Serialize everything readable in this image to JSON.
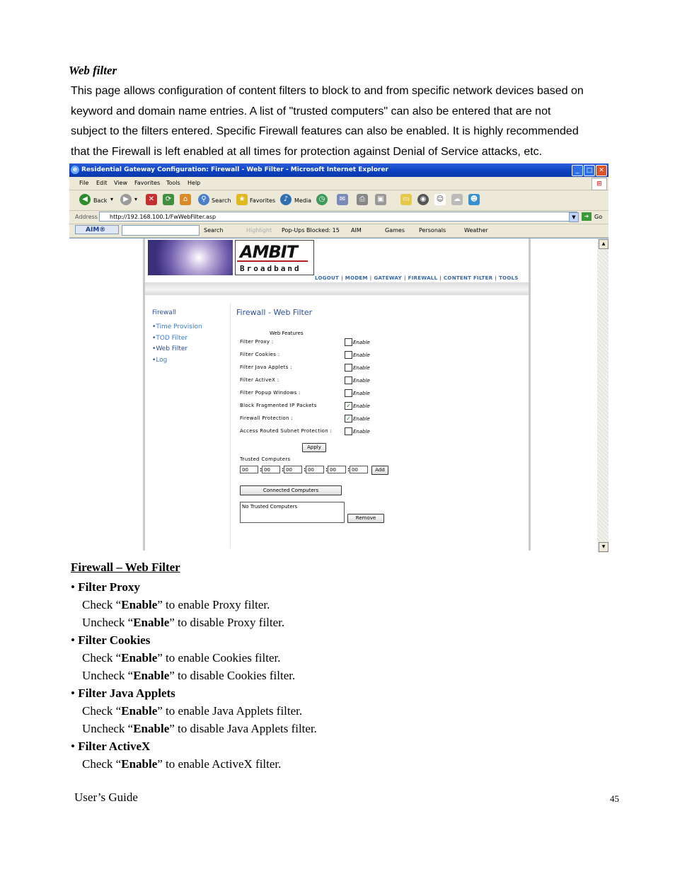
{
  "intro": {
    "title": "Web filter",
    "paragraph_lines": [
      "This page allows configuration of content filters to block to and from specific network devices based on",
      "keyword and domain name entries. A list of \"trusted computers\" can also be entered that are not",
      "subject to the filters entered. Specific Firewall features can also be enabled. It is highly recommended",
      "that the Firewall is left enabled at all times for protection against Denial of Service attacks, etc."
    ]
  },
  "browser": {
    "window_title": "Residential Gateway Configuration: Firewall - Web Filter - Microsoft Internet Explorer",
    "menu": [
      "File",
      "Edit",
      "View",
      "Favorites",
      "Tools",
      "Help"
    ],
    "toolbar": {
      "back": "Back",
      "search": "Search",
      "favorites": "Favorites",
      "media": "Media"
    },
    "address_label": "Address",
    "address_url": "http://192.168.100.1/FwWebFilter.asp",
    "go_label": "Go",
    "aim": {
      "button": "AIM®",
      "search": "Search",
      "highlight": "Highlight",
      "popups": "Pop-Ups Blocked: 15",
      "aim_menu": "AIM",
      "games": "Games",
      "personals": "Personals",
      "weather": "Weather"
    },
    "icons": {
      "back": "back-arrow-icon",
      "forward": "forward-arrow-icon",
      "stop": "stop-icon",
      "refresh": "refresh-icon",
      "home": "home-icon",
      "search": "magnifier-icon",
      "favorites": "star-icon",
      "media": "media-icon",
      "history": "history-icon",
      "mail": "mail-icon",
      "print": "printer-icon"
    }
  },
  "router": {
    "logo_word": "AMBIT",
    "logo_sub": "Broadband",
    "topnav": [
      "LOGOUT",
      "MODEM",
      "GATEWAY",
      "FIREWALL",
      "CONTENT FILTER",
      "TOOLS"
    ],
    "sidebar": {
      "title": "Firewall",
      "items": [
        "Time Provision",
        "TOD Filter",
        "Web Filter",
        "Log"
      ]
    },
    "main_title": "Firewall - Web Filter",
    "features_title": "Web Features",
    "enable_label": "Enable",
    "features": [
      {
        "label": "Filter Proxy :",
        "checked": false
      },
      {
        "label": "Filter Cookies :",
        "checked": false
      },
      {
        "label": "Filter Java Applets :",
        "checked": false
      },
      {
        "label": "Filter ActiveX :",
        "checked": false
      },
      {
        "label": "Filter Popup Windows :",
        "checked": false
      },
      {
        "label": "Block Fragmented IP Packets",
        "checked": true
      },
      {
        "label": "Firewall Protection :",
        "checked": true
      },
      {
        "label": "Access Routed Subnet Protection :",
        "checked": false
      }
    ],
    "apply_label": "Apply",
    "trusted_label": "Trusted Computers",
    "mac_values": [
      "00",
      "00",
      "00",
      "00",
      "00",
      "00"
    ],
    "add_label": "Add",
    "connected_label": "Connected Computers",
    "trusted_list_text": "No Trusted Computers",
    "remove_label": "Remove"
  },
  "section": {
    "heading": "Firewall – Web Filter",
    "items": [
      {
        "title": "Filter Proxy",
        "lines": [
          {
            "pre": "Check “",
            "bold": "Enable",
            "post": "” to enable Proxy filter."
          },
          {
            "pre": "Uncheck “",
            "bold": "Enable",
            "post": "” to disable Proxy filter."
          }
        ]
      },
      {
        "title": "Filter Cookies",
        "lines": [
          {
            "pre": "Check “",
            "bold": "Enable",
            "post": "” to enable Cookies filter."
          },
          {
            "pre": "Uncheck “",
            "bold": "Enable",
            "post": "” to disable Cookies filter."
          }
        ]
      },
      {
        "title": "Filter Java Applets",
        "lines": [
          {
            "pre": "Check “",
            "bold": "Enable",
            "post": "” to enable Java Applets filter."
          },
          {
            "pre": "Uncheck “",
            "bold": "Enable",
            "post": "” to disable Java Applets filter."
          }
        ]
      },
      {
        "title": "Filter ActiveX",
        "lines": [
          {
            "pre": "Check “",
            "bold": "Enable",
            "post": "” to enable ActiveX filter."
          }
        ]
      }
    ]
  },
  "footer": {
    "left": "User’s Guide",
    "page_number": "45"
  }
}
